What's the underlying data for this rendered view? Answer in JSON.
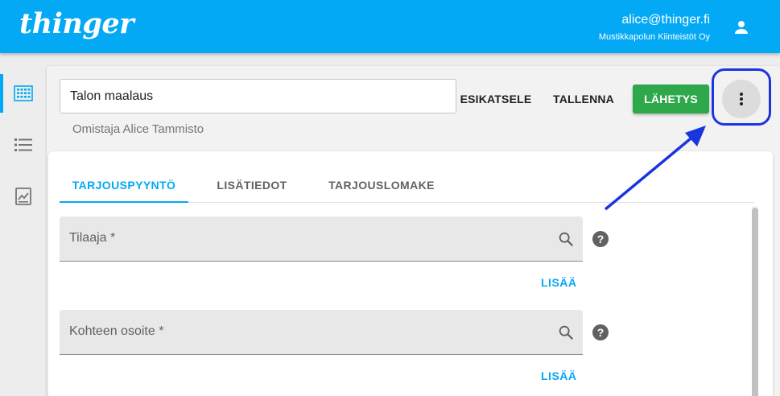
{
  "brand": {
    "logo_text": "thinger",
    "accent": "#03a9f4"
  },
  "user": {
    "email": "alice@thinger.fi",
    "organization": "Mustikkapolun Kiinteistöt Oy",
    "icon": "person-icon"
  },
  "sidebar": {
    "items": [
      {
        "icon": "dashboard-grid-icon",
        "active": true
      },
      {
        "icon": "list-icon",
        "active": false
      },
      {
        "icon": "report-icon",
        "active": false
      }
    ]
  },
  "toolbar": {
    "title_value": "Talon maalaus",
    "owner_text": "Omistaja Alice Tammisto",
    "preview_label": "ESIKATSELE",
    "save_label": "TALLENNA",
    "send_label": "LÄHETYS",
    "send_color": "#2ea84a",
    "more_icon": "more-vert-icon"
  },
  "tabs": [
    {
      "label": "TARJOUSPYYNTÖ",
      "active": true
    },
    {
      "label": "LISÄTIEDOT",
      "active": false
    },
    {
      "label": "TARJOUSLOMAKE",
      "active": false
    }
  ],
  "form": {
    "fields": [
      {
        "label": "Tilaaja *",
        "add_label": "LISÄÄ"
      },
      {
        "label": "Kohteen osoite *",
        "add_label": "LISÄÄ"
      }
    ]
  },
  "annotation": {
    "highlight_color": "#1a35e0"
  }
}
